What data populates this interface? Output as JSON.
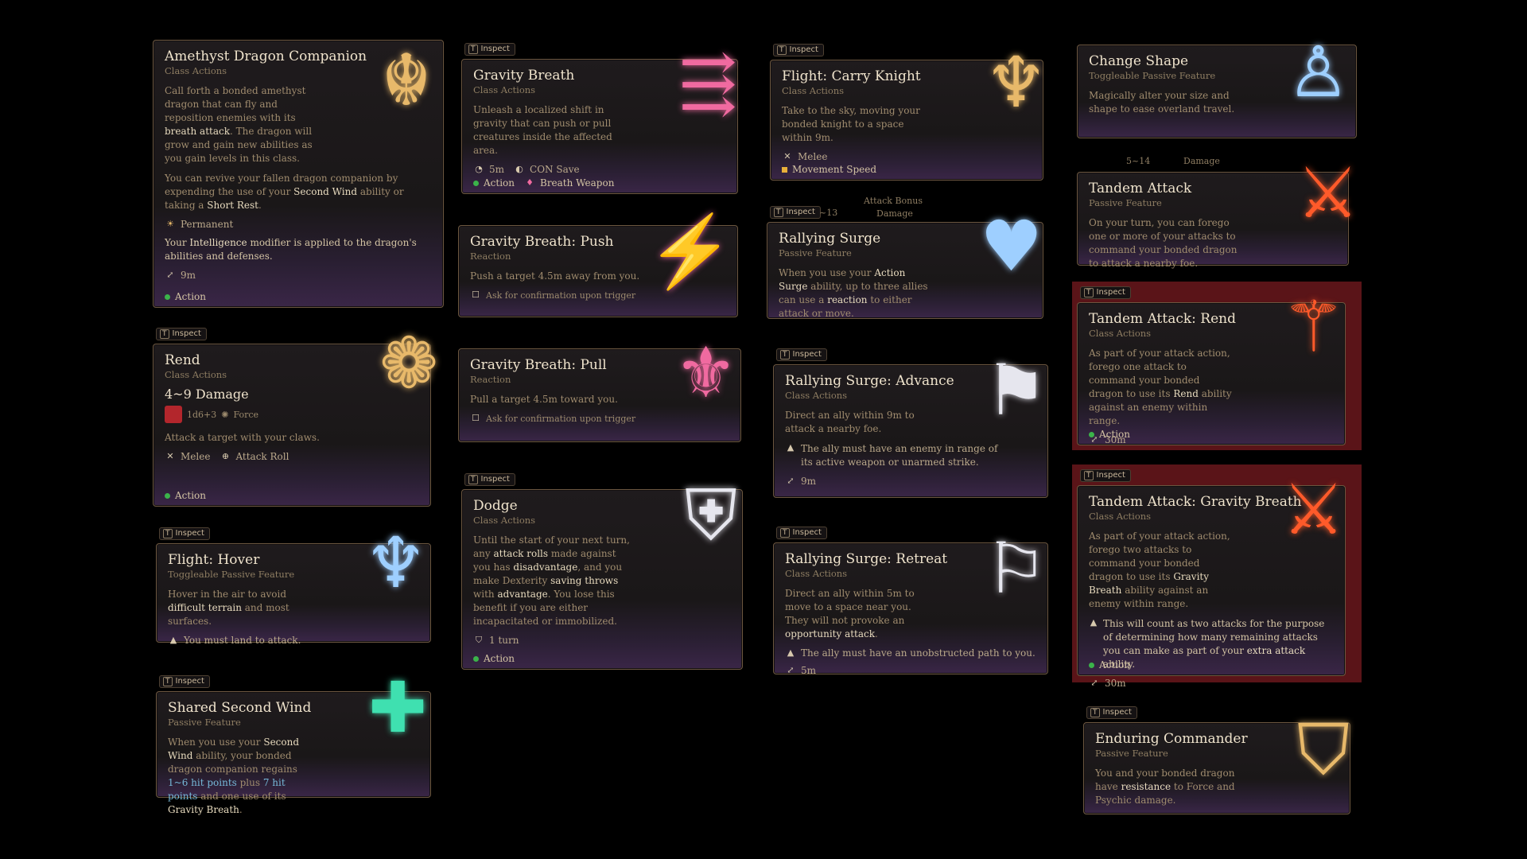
{
  "inspect_label": "Inspect",
  "cards": {
    "amethyst": {
      "title": "Amethyst Dragon Companion",
      "sub": "Class Actions",
      "desc1a": "Call forth a bonded amethyst dragon that can fly and reposition enemies with its ",
      "desc1b": "breath attack",
      "desc1c": ". The dragon will grow and gain new abilities as you gain levels in this class.",
      "desc2a": "You can revive your fallen dragon companion by expending the use of your ",
      "desc2b": "Second Wind",
      "desc2c": " ability or taking a ",
      "desc2d": "Short Rest",
      "desc2e": ".",
      "duration": "Permanent",
      "note_a": "Your ",
      "note_b": "Intelligence",
      "note_c": " modifier is applied to the dragon's abilities and defenses.",
      "range": "9m",
      "action": "Action"
    },
    "rend": {
      "title": "Rend",
      "sub": "Class Actions",
      "damage": "4~9 Damage",
      "dice": "1d6+3",
      "dmg_type": "Force",
      "desc": "Attack a target with your claws.",
      "tag1": "Melee",
      "tag2": "Attack Roll",
      "action": "Action"
    },
    "hover": {
      "title": "Flight: Hover",
      "sub": "Toggleable Passive Feature",
      "desc_a": "Hover in the air to avoid ",
      "desc_b": "difficult terrain",
      "desc_c": " and most surfaces.",
      "warn": "You must land to attack."
    },
    "shared": {
      "title": "Shared Second Wind",
      "sub": "Passive Feature",
      "d1": "When you use your ",
      "d2": "Second Wind",
      "d3": " ability, your bonded dragon companion regains ",
      "d4": "1~6 hit points",
      "d5": " plus ",
      "d6": "7 hit points",
      "d7": " and one use of its ",
      "d8": "Gravity Breath",
      "d9": "."
    },
    "gravity": {
      "title": "Gravity Breath",
      "sub": "Class Actions",
      "desc": "Unleash a localized shift in gravity that can push or pull creatures inside the affected area.",
      "range": "5m",
      "save": "CON Save",
      "action": "Action",
      "resource": "Breath Weapon"
    },
    "push": {
      "title": "Gravity Breath: Push",
      "sub": "Reaction",
      "desc": "Push a target 4.5m away from you.",
      "confirm": "Ask for confirmation upon trigger"
    },
    "pull": {
      "title": "Gravity Breath: Pull",
      "sub": "Reaction",
      "desc": "Pull a target 4.5m toward you.",
      "confirm": "Ask for confirmation upon trigger"
    },
    "dodge": {
      "title": "Dodge",
      "sub": "Class Actions",
      "d1": "Until the start of your next turn, any ",
      "d2": "attack rolls",
      "d3": " made against you has ",
      "d4": "disadvantage",
      "d5": ", and you make Dexterity ",
      "d6": "saving throws",
      "d7": " with ",
      "d8": "advantage",
      "d9": ". You lose this benefit if you are either incapacitated or immobilized.",
      "duration": "1 turn",
      "action": "Action"
    },
    "carry": {
      "title": "Flight: Carry Knight",
      "sub": "Class Actions",
      "desc": "Take to the sky, moving your bonded knight to a space within 9m.",
      "tag": "Melee",
      "resource": "Movement Speed"
    },
    "surge": {
      "title": "Rallying Surge",
      "sub": "Passive Feature",
      "hdr_a": "Attack Bonus",
      "hdr_b": "Damage",
      "hdr_c": "~13",
      "d1": "When you use your ",
      "d2": "Action Surge",
      "d3": " ability, up to three allies can use a ",
      "d4": "reaction",
      "d5": " to either attack or move."
    },
    "advance": {
      "title": "Rallying Surge: Advance",
      "sub": "Class Actions",
      "desc": "Direct an ally within 9m to attack a nearby foe.",
      "warn": "The ally must have an enemy in range of its active weapon or unarmed strike.",
      "range": "9m"
    },
    "retreat": {
      "title": "Rallying Surge: Retreat",
      "sub": "Class Actions",
      "d1": "Direct an ally within 5m to move to a space near you. They will not provoke an ",
      "d2": "opportunity attack",
      "d3": ".",
      "warn": "The ally must have an unobstructed path to you.",
      "range": "5m"
    },
    "shape": {
      "title": "Change Shape",
      "sub": "Toggleable Passive Feature",
      "desc": "Magically alter your size and shape to ease overland travel."
    },
    "tandem": {
      "title": "Tandem Attack",
      "sub": "Passive Feature",
      "hdr_a": "5~14",
      "hdr_b": "Damage",
      "desc": "On your turn, you can forego one or more of your attacks to command your bonded dragon to attack a nearby foe."
    },
    "tandem_rend": {
      "title": "Tandem Attack: Rend",
      "sub": "Class Actions",
      "d1": "As part of your attack action, forego one attack to command your bonded dragon to use its ",
      "d2": "Rend",
      "d3": " ability against an enemy within range.",
      "range": "30m",
      "action": "Action"
    },
    "tandem_gb": {
      "title": "Tandem Attack: Gravity Breath",
      "sub": "Class Actions",
      "d1": "As part of your attack action, forego two attacks to command your bonded dragon to use its ",
      "d2": "Gravity Breath",
      "d3": " ability against an enemy within range.",
      "w1": "This will count as two attacks for the purpose of determining how many remaining attacks you can make as part of your ",
      "w2": "extra attack",
      "w3": " ability.",
      "range": "30m",
      "action": "Action"
    },
    "enduring": {
      "title": "Enduring Commander",
      "sub": "Passive Feature",
      "d1": "You and your bonded dragon have ",
      "d2": "resistance",
      "d3": " to Force and Psychic damage."
    }
  },
  "colors": {
    "gold_glow": "#e8b96a",
    "pink_glow": "#f06aa0",
    "blue_glow": "#9ecfff",
    "white_glow": "#e6e6ee",
    "red_glow": "#ff5a2a",
    "teal_glow": "#3fe0b0",
    "action_dot": "#3bb34a"
  }
}
